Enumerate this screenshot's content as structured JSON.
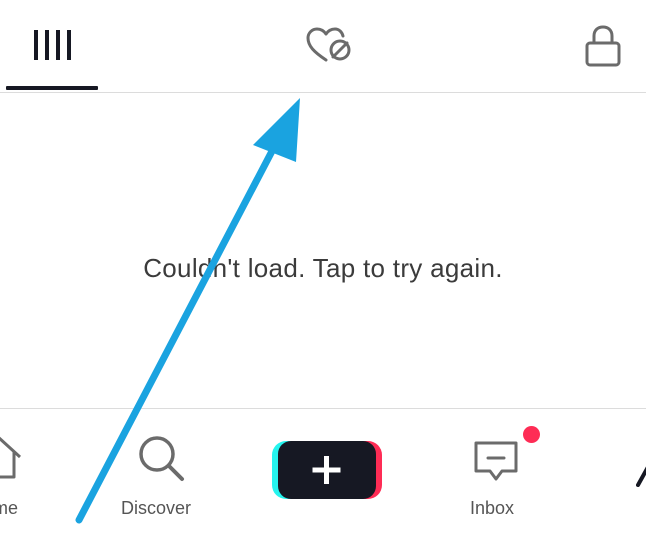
{
  "tabs": [
    {
      "id": "videos",
      "icon": "grid-bars-icon",
      "active": true
    },
    {
      "id": "liked",
      "icon": "hidden-heart-icon",
      "active": false
    },
    {
      "id": "private",
      "icon": "lock-icon",
      "active": false
    }
  ],
  "main": {
    "message": "Couldn't load. Tap to try again."
  },
  "bottom_nav": {
    "home_label": "me",
    "discover_label": "Discover",
    "inbox_label": "Inbox",
    "create_icon": "plus-icon"
  },
  "colors": {
    "accent_red": "#fe2c55",
    "accent_cyan": "#25f4ee",
    "annotation_arrow": "#1aa3e0",
    "text_primary": "#161823"
  }
}
